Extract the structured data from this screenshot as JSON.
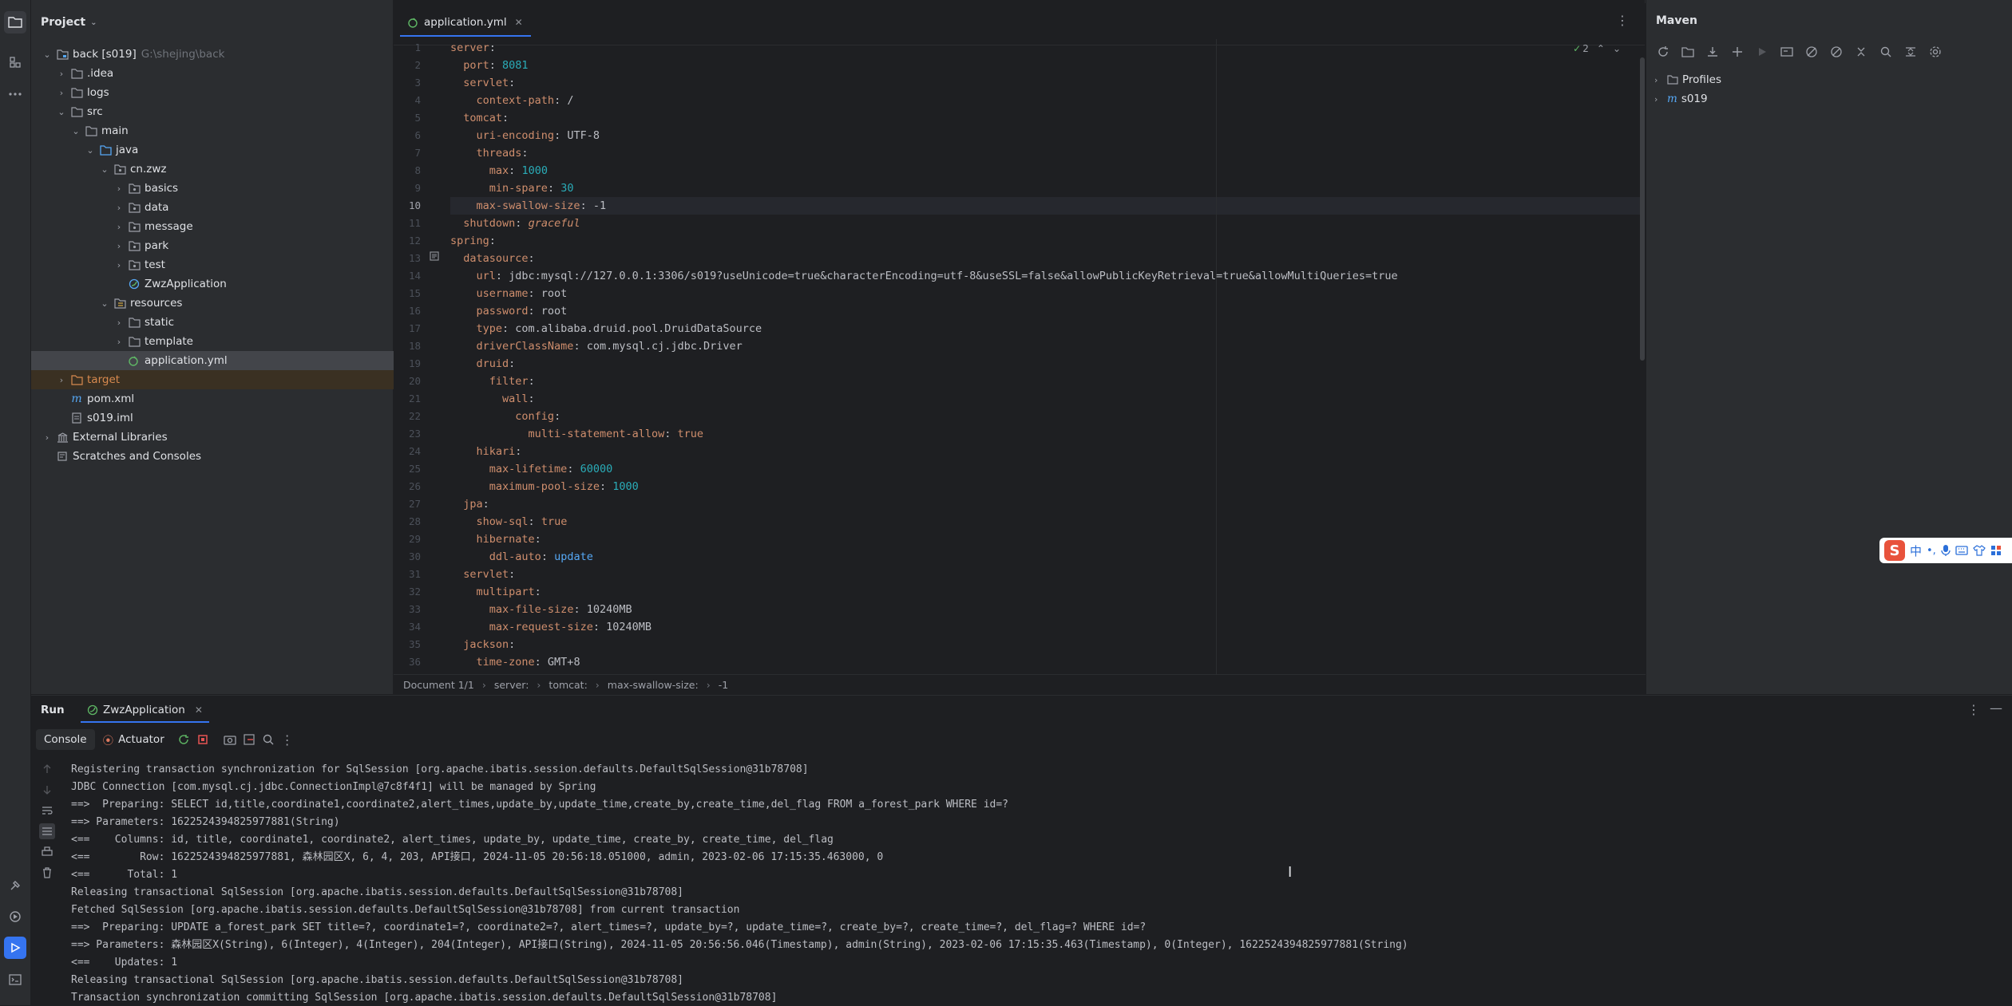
{
  "project": {
    "title": "Project",
    "tree": [
      {
        "label": "back [s019]",
        "hint": "G:\\shejing\\back",
        "arrow": "open",
        "icon": "module-folder-icon"
      },
      {
        "label": ".idea",
        "arrow": "closed",
        "icon": "folder-icon"
      },
      {
        "label": "logs",
        "arrow": "closed",
        "icon": "folder-icon"
      },
      {
        "label": "src",
        "arrow": "open",
        "icon": "folder-icon"
      },
      {
        "label": "main",
        "arrow": "open",
        "icon": "folder-icon"
      },
      {
        "label": "java",
        "arrow": "open",
        "icon": "source-folder-icon"
      },
      {
        "label": "cn.zwz",
        "arrow": "open",
        "icon": "package-icon"
      },
      {
        "label": "basics",
        "arrow": "closed",
        "icon": "package-icon"
      },
      {
        "label": "data",
        "arrow": "closed",
        "icon": "package-icon"
      },
      {
        "label": "message",
        "arrow": "closed",
        "icon": "package-icon"
      },
      {
        "label": "park",
        "arrow": "closed",
        "icon": "package-icon"
      },
      {
        "label": "test",
        "arrow": "closed",
        "icon": "package-icon"
      },
      {
        "label": "ZwzApplication",
        "arrow": "none",
        "icon": "spring-class-icon"
      },
      {
        "label": "resources",
        "arrow": "open",
        "icon": "resources-folder-icon"
      },
      {
        "label": "static",
        "arrow": "closed",
        "icon": "folder-icon"
      },
      {
        "label": "template",
        "arrow": "closed",
        "icon": "folder-icon"
      },
      {
        "label": "application.yml",
        "arrow": "none",
        "icon": "yaml-file-icon"
      },
      {
        "label": "target",
        "arrow": "closed",
        "icon": "excluded-folder-icon"
      },
      {
        "label": "pom.xml",
        "arrow": "none",
        "icon": "maven-file-icon"
      },
      {
        "label": "s019.iml",
        "arrow": "none",
        "icon": "iml-file-icon"
      },
      {
        "label": "External Libraries",
        "arrow": "closed",
        "icon": "library-icon"
      },
      {
        "label": "Scratches and Consoles",
        "arrow": "none",
        "icon": "scratches-icon"
      }
    ]
  },
  "editor": {
    "tab_label": "application.yml",
    "inspection_count": "2",
    "current_line": 10,
    "lines": [
      [
        [
          "k",
          "server"
        ],
        [
          "p",
          ":"
        ]
      ],
      [
        [
          "p",
          "  "
        ],
        [
          "k",
          "port"
        ],
        [
          "p",
          ": "
        ],
        [
          "n",
          "8081"
        ]
      ],
      [
        [
          "p",
          "  "
        ],
        [
          "k",
          "servlet"
        ],
        [
          "p",
          ":"
        ]
      ],
      [
        [
          "p",
          "    "
        ],
        [
          "k",
          "context-path"
        ],
        [
          "p",
          ": /"
        ]
      ],
      [
        [
          "p",
          "  "
        ],
        [
          "k",
          "tomcat"
        ],
        [
          "p",
          ":"
        ]
      ],
      [
        [
          "p",
          "    "
        ],
        [
          "k",
          "uri-encoding"
        ],
        [
          "p",
          ": UTF-8"
        ]
      ],
      [
        [
          "p",
          "    "
        ],
        [
          "k",
          "threads"
        ],
        [
          "p",
          ":"
        ]
      ],
      [
        [
          "p",
          "      "
        ],
        [
          "k",
          "max"
        ],
        [
          "p",
          ": "
        ],
        [
          "n",
          "1000"
        ]
      ],
      [
        [
          "p",
          "      "
        ],
        [
          "k",
          "min-spare"
        ],
        [
          "p",
          ": "
        ],
        [
          "n",
          "30"
        ]
      ],
      [
        [
          "p",
          "    "
        ],
        [
          "k",
          "max-swallow-size"
        ],
        [
          "p",
          ": -1"
        ]
      ],
      [
        [
          "p",
          "  "
        ],
        [
          "k",
          "shutdown"
        ],
        [
          "p",
          ": "
        ],
        [
          "it",
          "graceful"
        ]
      ],
      [
        [
          "k",
          "spring"
        ],
        [
          "p",
          ":"
        ]
      ],
      [
        [
          "p",
          "  "
        ],
        [
          "k",
          "datasource"
        ],
        [
          "p",
          ":"
        ]
      ],
      [
        [
          "p",
          "    "
        ],
        [
          "k",
          "url"
        ],
        [
          "p",
          ": jdbc:mysql://127.0.0.1:3306/s019?useUnicode=true&characterEncoding=utf-8&useSSL=false&allowPublicKeyRetrieval=true&allowMultiQueries=true"
        ]
      ],
      [
        [
          "p",
          "    "
        ],
        [
          "k",
          "username"
        ],
        [
          "p",
          ": root"
        ]
      ],
      [
        [
          "p",
          "    "
        ],
        [
          "k",
          "password"
        ],
        [
          "p",
          ": root"
        ]
      ],
      [
        [
          "p",
          "    "
        ],
        [
          "k",
          "type"
        ],
        [
          "p",
          ": com.alibaba.druid.pool.DruidDataSource"
        ]
      ],
      [
        [
          "p",
          "    "
        ],
        [
          "k",
          "driverClassName"
        ],
        [
          "p",
          ": com.mysql.cj.jdbc.Driver"
        ]
      ],
      [
        [
          "p",
          "    "
        ],
        [
          "k",
          "druid"
        ],
        [
          "p",
          ":"
        ]
      ],
      [
        [
          "p",
          "      "
        ],
        [
          "k",
          "filter"
        ],
        [
          "p",
          ":"
        ]
      ],
      [
        [
          "p",
          "        "
        ],
        [
          "k",
          "wall"
        ],
        [
          "p",
          ":"
        ]
      ],
      [
        [
          "p",
          "          "
        ],
        [
          "k",
          "config"
        ],
        [
          "p",
          ":"
        ]
      ],
      [
        [
          "p",
          "            "
        ],
        [
          "k",
          "multi-statement-allow"
        ],
        [
          "p",
          ": "
        ],
        [
          "b",
          "true"
        ]
      ],
      [
        [
          "p",
          "    "
        ],
        [
          "k",
          "hikari"
        ],
        [
          "p",
          ":"
        ]
      ],
      [
        [
          "p",
          "      "
        ],
        [
          "k",
          "max-lifetime"
        ],
        [
          "p",
          ": "
        ],
        [
          "n",
          "60000"
        ]
      ],
      [
        [
          "p",
          "      "
        ],
        [
          "k",
          "maximum-pool-size"
        ],
        [
          "p",
          ": "
        ],
        [
          "n",
          "1000"
        ]
      ],
      [
        [
          "p",
          "  "
        ],
        [
          "k",
          "jpa"
        ],
        [
          "p",
          ":"
        ]
      ],
      [
        [
          "p",
          "    "
        ],
        [
          "k",
          "show-sql"
        ],
        [
          "p",
          ": "
        ],
        [
          "b",
          "true"
        ]
      ],
      [
        [
          "p",
          "    "
        ],
        [
          "k",
          "hibernate"
        ],
        [
          "p",
          ":"
        ]
      ],
      [
        [
          "p",
          "      "
        ],
        [
          "k",
          "ddl-auto"
        ],
        [
          "p",
          ": "
        ],
        [
          "u",
          "update"
        ]
      ],
      [
        [
          "p",
          "  "
        ],
        [
          "k",
          "servlet"
        ],
        [
          "p",
          ":"
        ]
      ],
      [
        [
          "p",
          "    "
        ],
        [
          "k",
          "multipart"
        ],
        [
          "p",
          ":"
        ]
      ],
      [
        [
          "p",
          "      "
        ],
        [
          "k",
          "max-file-size"
        ],
        [
          "p",
          ": 10240MB"
        ]
      ],
      [
        [
          "p",
          "      "
        ],
        [
          "k",
          "max-request-size"
        ],
        [
          "p",
          ": 10240MB"
        ]
      ],
      [
        [
          "p",
          "  "
        ],
        [
          "k",
          "jackson"
        ],
        [
          "p",
          ":"
        ]
      ],
      [
        [
          "p",
          "    "
        ],
        [
          "k",
          "time-zone"
        ],
        [
          "p",
          ": GMT+8"
        ]
      ]
    ],
    "breadcrumbs": [
      "Document 1/1",
      "server:",
      "tomcat:",
      "max-swallow-size:",
      "-1"
    ]
  },
  "maven": {
    "title": "Maven",
    "items": [
      {
        "label": "Profiles",
        "icon": "folder-icon"
      },
      {
        "label": "s019",
        "icon": "maven-module-icon"
      }
    ]
  },
  "run": {
    "title": "Run",
    "tab_label": "ZwzApplication",
    "console_tab": "Console",
    "actuator_tab": "Actuator",
    "log_lines": [
      "Registering transaction synchronization for SqlSession [org.apache.ibatis.session.defaults.DefaultSqlSession@31b78708]",
      "JDBC Connection [com.mysql.cj.jdbc.ConnectionImpl@7c8f4f1] will be managed by Spring",
      "==>  Preparing: SELECT id,title,coordinate1,coordinate2,alert_times,update_by,update_time,create_by,create_time,del_flag FROM a_forest_park WHERE id=?",
      "==> Parameters: 1622524394825977881(String)",
      "<==    Columns: id, title, coordinate1, coordinate2, alert_times, update_by, update_time, create_by, create_time, del_flag",
      "<==        Row: 1622524394825977881, 森林园区X, 6, 4, 203, API接口, 2024-11-05 20:56:18.051000, admin, 2023-02-06 17:15:35.463000, 0",
      "<==      Total: 1",
      "Releasing transactional SqlSession [org.apache.ibatis.session.defaults.DefaultSqlSession@31b78708]",
      "Fetched SqlSession [org.apache.ibatis.session.defaults.DefaultSqlSession@31b78708] from current transaction",
      "==>  Preparing: UPDATE a_forest_park SET title=?, coordinate1=?, coordinate2=?, alert_times=?, update_by=?, update_time=?, create_by=?, create_time=?, del_flag=? WHERE id=?",
      "==> Parameters: 森林园区X(String), 6(Integer), 4(Integer), 204(Integer), API接口(String), 2024-11-05 20:56:56.046(Timestamp), admin(String), 2023-02-06 17:15:35.463(Timestamp), 0(Integer), 1622524394825977881(String)",
      "<==    Updates: 1",
      "Releasing transactional SqlSession [org.apache.ibatis.session.defaults.DefaultSqlSession@31b78708]",
      "Transaction synchronization committing SqlSession [org.apache.ibatis.session.defaults.DefaultSqlSession@31b78708]"
    ]
  },
  "ime": {
    "label": "中"
  },
  "colors": {
    "accent": "#3574f0",
    "bg": "#1e1f22",
    "panel": "#2b2d30"
  }
}
